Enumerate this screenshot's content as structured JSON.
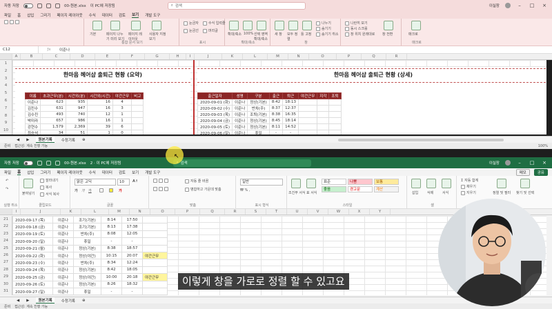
{
  "top_window": {
    "autosave_label": "자동 저장",
    "filename": "00-원본.xlsx",
    "saved_state": "이 PC에 저장됨",
    "search_placeholder": "검색",
    "user_name": "이실장",
    "menu": [
      "파일",
      "홈",
      "삽입",
      "그리기",
      "페이지 레이아웃",
      "수식",
      "데이터",
      "검토",
      "보기",
      "개발 도구"
    ],
    "active_menu_index": 8,
    "ribbon_groups": [
      {
        "name": "시트 보기",
        "items": [
          "기본",
          "페이지 나누기 미리 보기",
          "페이지 레이아웃",
          "사용자 지정 보기"
        ]
      },
      {
        "name": "통합 문서 보기",
        "items": [
          "눈금자",
          "수식 입력줄",
          "눈금선",
          "머리글"
        ]
      },
      {
        "name": "표시",
        "items": [
          "확대/축소",
          "100%",
          "선택 영역 확대/축소"
        ]
      },
      {
        "name": "확대/축소",
        "items": [
          "새 창",
          "모두 정렬",
          "틀 고정",
          "나누기",
          "숨기기",
          "숨기기 취소"
        ]
      },
      {
        "name": "창",
        "items": [
          "나란히 보기",
          "동시 스크롤",
          "창 위치 원래대로",
          "창 전환"
        ]
      },
      {
        "name": "매크로",
        "items": [
          "매크로"
        ]
      }
    ],
    "name_box": "C12",
    "formula": "이준나",
    "columns": [
      "A",
      "B",
      "C",
      "D",
      "E",
      "F",
      "G",
      "H",
      "I",
      "J",
      "K",
      "L",
      "M",
      "N",
      "O",
      "P",
      "Q",
      "R"
    ],
    "row_numbers": [
      "1",
      "2",
      "3",
      "4",
      "5",
      "6",
      "7",
      "8",
      "9",
      "10"
    ],
    "summary": {
      "title": "한마음 헤어샵 출퇴근 현황 (요약)",
      "headers": [
        "이름",
        "초과근무(분)",
        "시간외(분)",
        "시간외(시간)",
        "야간근무",
        "비고"
      ],
      "rows": [
        [
          "이준나",
          "623",
          "935",
          "16",
          "4",
          ""
        ],
        [
          "김진수",
          "631",
          "947",
          "16",
          "3",
          ""
        ],
        [
          "김수진",
          "493",
          "740",
          "12",
          "1",
          ""
        ],
        [
          "박미라",
          "657",
          "986",
          "16",
          "1",
          ""
        ],
        [
          "강현수",
          "1,579",
          "2,369",
          "39",
          "6",
          ""
        ],
        [
          "최승석",
          "34",
          "51",
          "1",
          "0",
          ""
        ]
      ]
    },
    "detail": {
      "title": "한마음 헤어샵 출퇴근 현황 (상세)",
      "headers": [
        "출근일자",
        "성명",
        "구분",
        "출근",
        "퇴근",
        "야간근무",
        "지각",
        "조퇴"
      ],
      "rows": [
        [
          "2020-09-01 (화)",
          "이준나",
          "정상(기본)",
          "8:42",
          "18:13",
          "",
          "",
          ""
        ],
        [
          "2020-09-02 (수)",
          "이준나",
          "반차(주)",
          "8:37",
          "12:37",
          "",
          "",
          ""
        ],
        [
          "2020-09-03 (목)",
          "이준나",
          "조퇴(기본)",
          "8:38",
          "16:35",
          "",
          "",
          ""
        ],
        [
          "2020-09-04 (금)",
          "이준나",
          "정상(기본)",
          "8:45",
          "18:14",
          "",
          "",
          ""
        ],
        [
          "2020-09-05 (토)",
          "이준나",
          "정상(기본)",
          "8:11",
          "14:52",
          "",
          "",
          ""
        ],
        [
          "2020-09-06 (일)",
          "이준나",
          "휴일",
          "-",
          "-",
          "",
          "",
          ""
        ]
      ]
    },
    "sheet_tabs": [
      "원본기록",
      "수정기록"
    ],
    "active_tab_index": 0,
    "status": "준비",
    "accessibility": "접근성: 계속 진행 가능",
    "zoom": "100%"
  },
  "bottom_window": {
    "autosave_label": "자동 저장",
    "filename": "00-원본.xlsx",
    "saved_state": "2 · 이 PC에 저장됨",
    "search_placeholder": "검색",
    "user_name": "이실장",
    "menu": [
      "파일",
      "홈",
      "삽입",
      "그리기",
      "페이지 레이아웃",
      "수식",
      "데이터",
      "검토",
      "보기",
      "개발 도구"
    ],
    "active_menu_index": 1,
    "memo_label": "메모",
    "share_label": "공유",
    "clipboard": {
      "paste": "붙여넣기",
      "cut": "잘라내기",
      "copy": "복사",
      "format_painter": "서식 복사",
      "group": "클립보드"
    },
    "undo_group": "실행 취소",
    "font": {
      "name": "맑은 고딕",
      "size": "10",
      "group": "글꼴"
    },
    "align": {
      "wrap": "자동 줄 바꿈",
      "merge": "병합하고 가운데 맞춤",
      "group": "맞춤"
    },
    "number": {
      "format": "일반",
      "group": "표시 형식"
    },
    "styles": {
      "cells": [
        "표준",
        "나쁨",
        "보통",
        "좋음",
        "경고문",
        "계산"
      ],
      "conditional": "조건부 서식",
      "table": "표 서식",
      "group": "스타일"
    },
    "cells_group": {
      "items": [
        "삽입",
        "삭제",
        "서식"
      ],
      "group": "셀"
    },
    "editing": {
      "items": [
        "자동 합계",
        "채우기",
        "지우기",
        "정렬 및 필터",
        "찾기 및 선택"
      ],
      "group": "편집"
    },
    "columns": [
      "I",
      "J",
      "K",
      "L",
      "M",
      "N",
      "O",
      "P",
      "Q",
      "R",
      "S",
      "T",
      "U",
      "V",
      "W",
      "X",
      "Y"
    ],
    "row_numbers": [
      "21",
      "22",
      "23",
      "24",
      "25",
      "26",
      "27",
      "28",
      "29",
      "30",
      "31"
    ],
    "rows": [
      [
        "2020-09-17 (목)",
        "이준나",
        "조기(기본)",
        "8:14",
        "17:50",
        ""
      ],
      [
        "2020-09-18 (금)",
        "이준나",
        "조기(기본)",
        "8:13",
        "17:38",
        ""
      ],
      [
        "2020-09-19 (토)",
        "이준나",
        "반차(주)",
        "8:08",
        "12:05",
        ""
      ],
      [
        "2020-09-20 (일)",
        "이준나",
        "휴일",
        "-",
        "-",
        ""
      ],
      [
        "2020-09-21 (월)",
        "이준나",
        "정상(기본)",
        "8:38",
        "18:57",
        ""
      ],
      [
        "2020-09-22 (화)",
        "이준나",
        "정상(야간)",
        "10:15",
        "20:07",
        "야간근무"
      ],
      [
        "2020-09-23 (수)",
        "이준나",
        "반차(주)",
        "8:34",
        "12:24",
        ""
      ],
      [
        "2020-09-24 (목)",
        "이준나",
        "정상(기본)",
        "8:42",
        "18:05",
        ""
      ],
      [
        "2020-09-25 (금)",
        "이준나",
        "정상(야간)",
        "10:00",
        "20:18",
        "야간근무"
      ],
      [
        "2020-09-26 (토)",
        "이준나",
        "정상(기본)",
        "8:26",
        "18:32",
        ""
      ],
      [
        "2020-09-27 (일)",
        "이준나",
        "휴일",
        "-",
        "-",
        ""
      ]
    ],
    "sheet_tabs": [
      "원본기록",
      "수정기록"
    ],
    "active_tab_index": 0,
    "status": "준비",
    "accessibility": "접근성: 계속 진행 가능",
    "zoom": "100%"
  },
  "subtitle": "이렇게 창을 가로로 정렬 할 수 있고요",
  "colors": {
    "excel_green": "#1f6e43",
    "header_red": "#8b2525",
    "highlight_yellow": "#fff59d",
    "top_tint": "#f5dcdc"
  }
}
